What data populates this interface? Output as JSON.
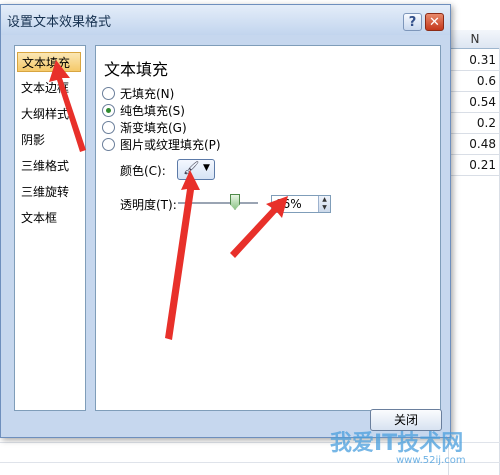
{
  "dialog": {
    "title": "设置文本效果格式",
    "help_label": "?",
    "close_x": "✕",
    "close_button": "关闭"
  },
  "nav": {
    "items": [
      {
        "label": "文本填充",
        "selected": true
      },
      {
        "label": "文本边框",
        "selected": false
      },
      {
        "label": "大纲样式",
        "selected": false
      },
      {
        "label": "阴影",
        "selected": false
      },
      {
        "label": "三维格式",
        "selected": false
      },
      {
        "label": "三维旋转",
        "selected": false
      },
      {
        "label": "文本框",
        "selected": false
      }
    ]
  },
  "panel": {
    "heading": "文本填充",
    "options": [
      {
        "label": "无填充(N)",
        "checked": false
      },
      {
        "label": "纯色填充(S)",
        "checked": true
      },
      {
        "label": "渐变填充(G)",
        "checked": false
      },
      {
        "label": "图片或纹理填充(P)",
        "checked": false
      }
    ],
    "color_label": "颜色(C):",
    "color_icon": "paint-bucket-icon",
    "transparency_label": "透明度(T):",
    "transparency_value": "66%",
    "transparency_level": 0.66
  },
  "sheet": {
    "column_header": "N",
    "values": [
      "0.31",
      "0.6",
      "0.54",
      "0.2",
      "0.48",
      "0.21"
    ]
  },
  "watermark": {
    "text": "我爱IT技术网",
    "site": "www.52ij.com"
  },
  "colors": {
    "accent_arrow": "#e8302a",
    "selected_nav": "#f5c96a",
    "dialog_bg": "#c6d7ee"
  }
}
